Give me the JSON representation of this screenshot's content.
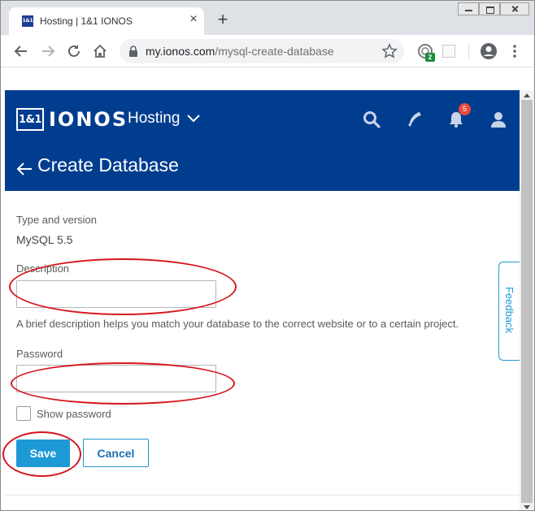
{
  "browser": {
    "tab_title": "Hosting | 1&1 IONOS",
    "favicon_text": "1&1",
    "url_host": "my.ionos.com",
    "url_path": "/mysql-create-database",
    "extension_badge": "2"
  },
  "header": {
    "logo_mark": "1&1",
    "logo_text": "IONOS",
    "product": "Hosting",
    "notification_count": "5",
    "bar_color": "#003d8f"
  },
  "page": {
    "title": "Create Database"
  },
  "form": {
    "type_label": "Type and version",
    "type_value": "MySQL 5.5",
    "description_label": "Description",
    "description_value": "",
    "description_helper": "A brief description helps you match your database to the correct website or to a certain project.",
    "password_label": "Password",
    "password_value": "",
    "show_password_label": "Show password",
    "show_password_checked": false,
    "save_label": "Save",
    "cancel_label": "Cancel"
  },
  "feedback_label": "Feedback",
  "colors": {
    "accent": "#1d9ad6",
    "annotation": "#d6161d"
  }
}
